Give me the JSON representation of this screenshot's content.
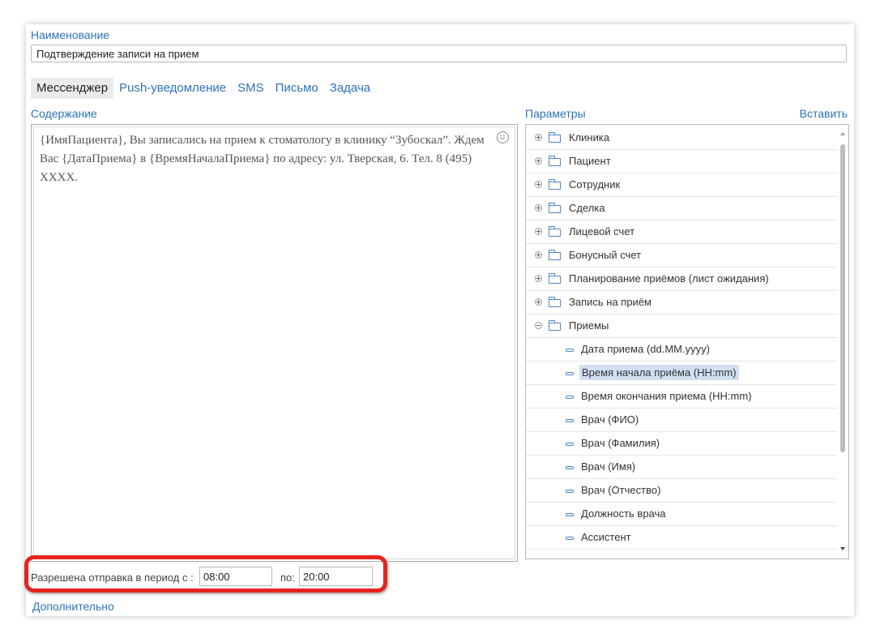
{
  "form": {
    "name_label": "Наименование",
    "name_value": "Подтверждение записи на прием"
  },
  "tabs": [
    {
      "label": "Мессенджер",
      "active": true
    },
    {
      "label": "Push-уведомление",
      "active": false
    },
    {
      "label": "SMS",
      "active": false
    },
    {
      "label": "Письмо",
      "active": false
    },
    {
      "label": "Задача",
      "active": false
    }
  ],
  "content": {
    "label": "Содержание",
    "text": "{ИмяПациента}, Вы записались на прием к стоматологу в клинику “Зубоскал”. Ждем Вас {ДатаПриема} в {ВремяНачалаПриема} по адресу: ул. Тверская, 6. Тел. 8 (495) XXXX.",
    "emoji_icon": "smiley-icon"
  },
  "params": {
    "label": "Параметры",
    "insert_label": "Вставить",
    "groups": [
      {
        "label": "Клиника",
        "expanded": false
      },
      {
        "label": "Пациент",
        "expanded": false
      },
      {
        "label": "Сотрудник",
        "expanded": false
      },
      {
        "label": "Сделка",
        "expanded": false
      },
      {
        "label": "Лицевой счет",
        "expanded": false
      },
      {
        "label": "Бонусный счет",
        "expanded": false
      },
      {
        "label": "Планирование приёмов (лист ожидания)",
        "expanded": false
      },
      {
        "label": "Запись на приём",
        "expanded": false
      },
      {
        "label": "Приемы",
        "expanded": true
      }
    ],
    "items": [
      {
        "label": "Дата приема (dd.MM.yyyy)",
        "selected": false
      },
      {
        "label": "Время начала приёма (HH:mm)",
        "selected": true
      },
      {
        "label": "Время окончания приема (HH:mm)",
        "selected": false
      },
      {
        "label": "Врач (ФИО)",
        "selected": false
      },
      {
        "label": "Врач (Фамилия)",
        "selected": false
      },
      {
        "label": "Врач (Имя)",
        "selected": false
      },
      {
        "label": "Врач (Отчество)",
        "selected": false
      },
      {
        "label": "Должность врача",
        "selected": false
      },
      {
        "label": "Ассистент",
        "selected": false
      }
    ]
  },
  "period": {
    "label": "Разрешена отправка в период с :",
    "from": "08:00",
    "to_label": "по:",
    "to": "20:00"
  },
  "footer": {
    "more_link": "Дополнительно"
  },
  "colors": {
    "link": "#2d72b8",
    "highlight_frame": "#e8231e",
    "selected_item_bg": "#cfe0f2",
    "tree_icon": "#4a86c5"
  }
}
